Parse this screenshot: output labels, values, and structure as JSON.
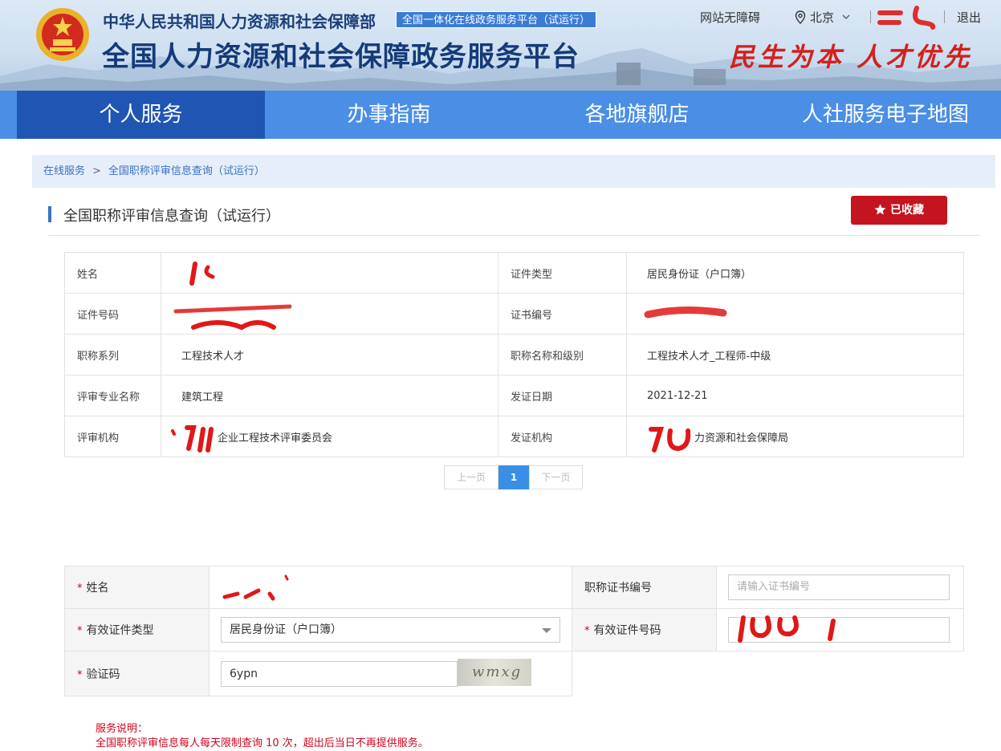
{
  "header": {
    "ministry": "中华人民共和国人力资源和社会保障部",
    "trial_tag": "全国一体化在线政务服务平台（试运行）",
    "platform_title": "全国人力资源和社会保障政务服务平台",
    "accessibility_link": "网站无障碍",
    "city": "北京",
    "logout": "退出",
    "slogan": "民生为本 人才优先",
    "brand_red": "#d3201c"
  },
  "nav": {
    "items": [
      "个人服务",
      "办事指南",
      "各地旗舰店",
      "人社服务电子地图"
    ],
    "active_index": 0
  },
  "breadcrumb": {
    "items": [
      "在线服务",
      "全国职称评审信息查询（试运行）"
    ],
    "separator": ">"
  },
  "section": {
    "title": "全国职称评审信息查询（试运行）",
    "favorite_label": "已收藏"
  },
  "result": {
    "rows": [
      {
        "l1": "姓名",
        "v1": "",
        "l2": "证件类型",
        "v2": "居民身份证（户口簿）"
      },
      {
        "l1": "证件号码",
        "v1": "",
        "l2": "证书编号",
        "v2": ""
      },
      {
        "l1": "职称系列",
        "v1": "工程技术人才",
        "l2": "职称名称和级别",
        "v2": "工程技术人才_工程师-中级"
      },
      {
        "l1": "评审专业名称",
        "v1": "建筑工程",
        "l2": "发证日期",
        "v2": "2021-12-21"
      },
      {
        "l1": "评审机构",
        "v1": "企业工程技术评审委员会",
        "l2": "发证机构",
        "v2": "力资源和社会保障局"
      }
    ]
  },
  "pager": {
    "prev": "上一页",
    "current": "1",
    "next": "下一页"
  },
  "form": {
    "required_mark": "*",
    "name_label": "姓名",
    "name_value": "",
    "cert_no_label": "职称证书编号",
    "cert_no_placeholder": "请输入证书编号",
    "id_type_label": "有效证件类型",
    "id_type_value": "居民身份证（户口簿）",
    "id_no_label": "有效证件号码",
    "id_no_value": "",
    "captcha_label": "验证码",
    "captcha_value": "6ypn",
    "captcha_image_text": "wmxg"
  },
  "notice": {
    "title": "服务说明：",
    "text": "全国职称评审信息每人每天限制查询 10 次，超出后当日不再提供服务。"
  }
}
